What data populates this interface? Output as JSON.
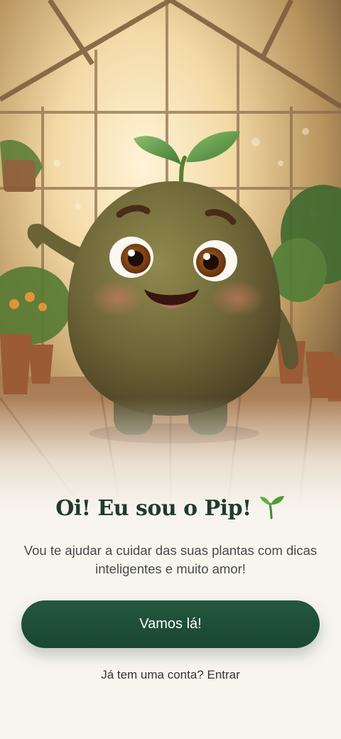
{
  "onboarding": {
    "title": "Oi! Eu sou o Pip!",
    "title_icon": "sprout-icon",
    "subtitle": "Vou te ajudar a cuidar das suas plantas com dicas inteligentes e muito amor!",
    "primary_button_label": "Vamos lá!",
    "login_prompt": "Já tem uma conta?",
    "login_link": "Entrar"
  },
  "hero": {
    "image": "pip-avocado-mascot-in-greenhouse",
    "scene": "greenhouse"
  },
  "colors": {
    "background": "#f8f5ef",
    "title": "#1f3b2d",
    "button": "#1f5136",
    "button_text": "#ffffff",
    "body_text": "#4a4a4a"
  }
}
